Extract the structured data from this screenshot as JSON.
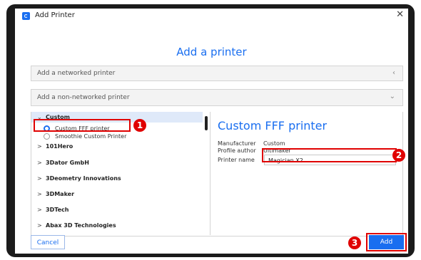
{
  "window": {
    "title": "Add Printer",
    "close_glyph": "✕"
  },
  "dialog": {
    "heading": "Add a printer"
  },
  "sections": {
    "networked": {
      "label": "Add a networked printer",
      "chevron": "‹"
    },
    "non_networked": {
      "label": "Add a non-networked printer",
      "chevron": "⌄"
    }
  },
  "tree": {
    "expanded_category": {
      "arrow": "⌄",
      "label": "Custom"
    },
    "options": [
      {
        "label": "Custom FFF printer",
        "selected": true
      },
      {
        "label": "Smoothie Custom Printer",
        "selected": false
      }
    ],
    "categories": [
      {
        "arrow": ">",
        "label": "101Hero"
      },
      {
        "arrow": ">",
        "label": "3Dator GmbH"
      },
      {
        "arrow": ">",
        "label": "3Deometry Innovations"
      },
      {
        "arrow": ">",
        "label": "3DMaker"
      },
      {
        "arrow": ">",
        "label": "3DTech"
      },
      {
        "arrow": ">",
        "label": "Abax 3D Technologies"
      }
    ]
  },
  "details": {
    "title": "Custom FFF printer",
    "manufacturer_label": "Manufacturer",
    "manufacturer_value": "Custom",
    "author_label": "Profile author",
    "author_value": "Ultimaker",
    "name_label": "Printer name",
    "name_value": "Magician X2"
  },
  "badges": {
    "one": "1",
    "two": "2",
    "three": "3"
  },
  "buttons": {
    "cancel": "Cancel",
    "add": "Add"
  },
  "colors": {
    "accent": "#196ef0",
    "annotation": "#e00000",
    "frame": "#1b1b1b"
  }
}
